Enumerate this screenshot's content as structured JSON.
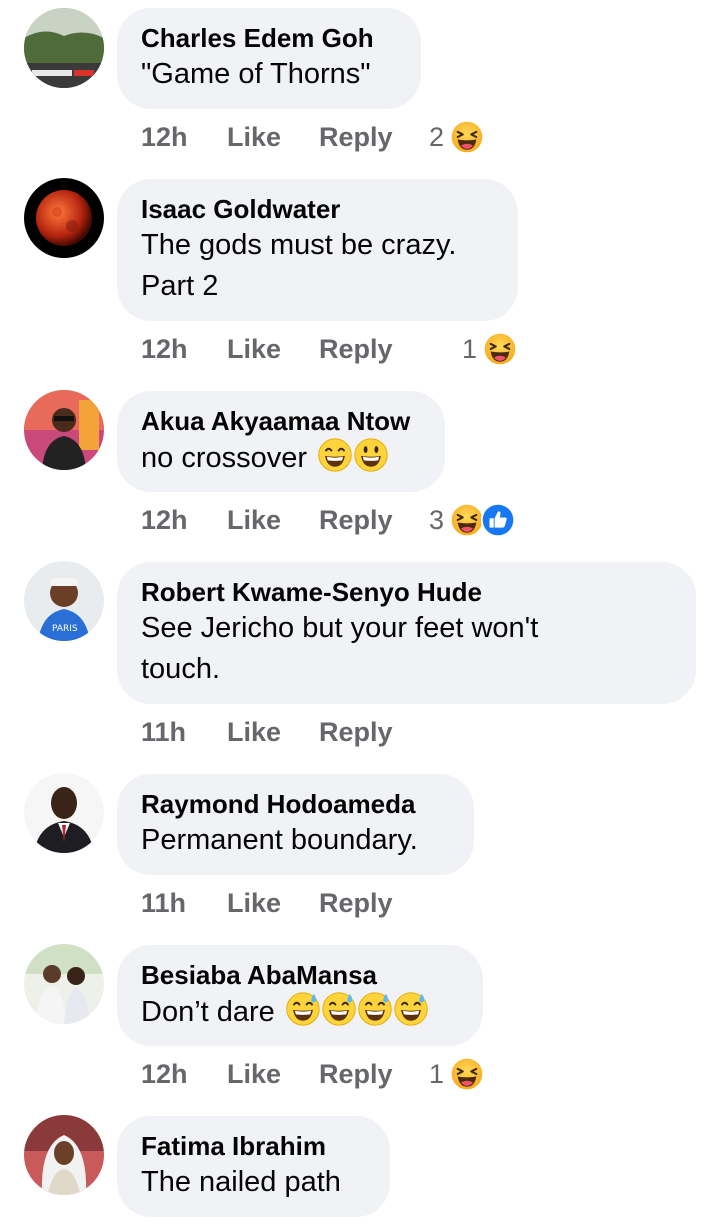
{
  "comments": [
    {
      "author": "Charles Edem Goh",
      "text": "\"Game of Thorns\"",
      "time": "12h",
      "like": "Like",
      "reply": "Reply",
      "reaction_count": "2",
      "reactions": [
        "haha-icon"
      ]
    },
    {
      "author": "Isaac Goldwater",
      "text_line1": "The gods must be crazy.",
      "text_line2": "Part 2",
      "time": "12h",
      "like": "Like",
      "reply": "Reply",
      "reaction_count": "1",
      "reactions": [
        "haha-icon"
      ]
    },
    {
      "author": "Akua Akyaamaa Ntow",
      "text": "no crossover",
      "text_emojis": [
        "grinning-squinting-emoji",
        "grinning-emoji"
      ],
      "time": "12h",
      "like": "Like",
      "reply": "Reply",
      "reaction_count": "3",
      "reactions": [
        "haha-icon",
        "like-icon"
      ]
    },
    {
      "author": "Robert Kwame-Senyo Hude",
      "text_line1": "See Jericho but your feet won't",
      "text_line2": "touch.",
      "time": "11h",
      "like": "Like",
      "reply": "Reply"
    },
    {
      "author": "Raymond Hodoameda",
      "text": "Permanent boundary.",
      "time": "11h",
      "like": "Like",
      "reply": "Reply"
    },
    {
      "author": "Besiaba AbaMansa",
      "text": "Don’t dare",
      "text_emojis": [
        "grinning-sweat-emoji",
        "grinning-sweat-emoji",
        "grinning-sweat-emoji",
        "grinning-sweat-emoji"
      ],
      "time": "12h",
      "like": "Like",
      "reply": "Reply",
      "reaction_count": "1",
      "reactions": [
        "haha-icon"
      ]
    },
    {
      "author": "Fatima Ibrahim",
      "text": "The nailed path"
    }
  ],
  "colors": {
    "bubble_bg": "#f0f2f5",
    "meta_text": "#65676b",
    "like_blue": "#1877f2",
    "emoji_yellow": "#f7b125"
  }
}
